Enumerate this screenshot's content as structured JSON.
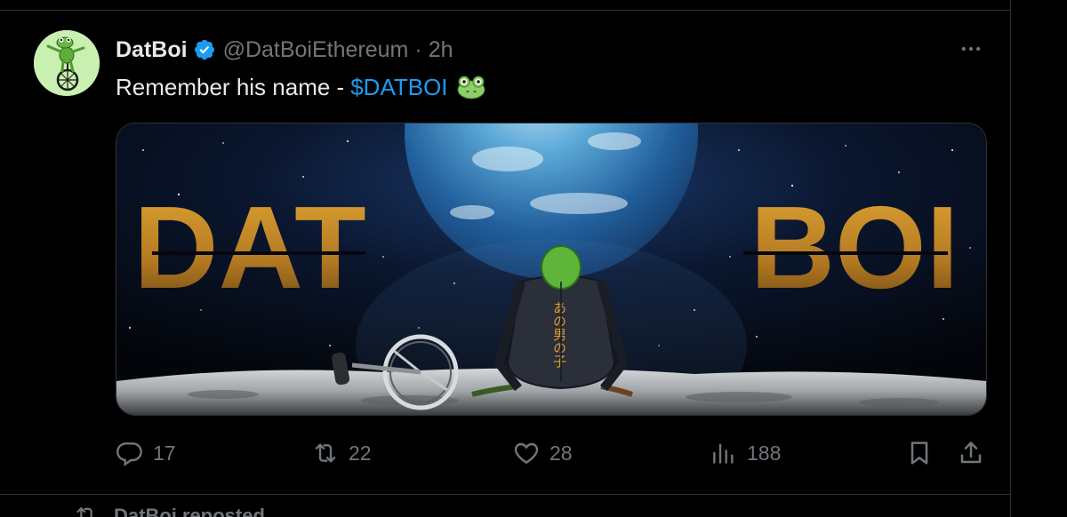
{
  "tweet": {
    "display_name": "DatBoi",
    "handle": "@DatBoiEthereum",
    "separator": "·",
    "time": "2h",
    "text": "Remember his name - ",
    "cashtag": "$DATBOI",
    "media": {
      "left_word": "DAT",
      "right_word": "BOI",
      "jacket_text": "あの男の子"
    }
  },
  "actions": {
    "replies": "17",
    "reposts": "22",
    "likes": "28",
    "views": "188"
  },
  "next": {
    "reposted_label": "DatBoi reposted"
  },
  "icons": {
    "verified": "verified-badge-icon",
    "more": "more-options-icon",
    "reply": "reply-icon",
    "repost": "repost-icon",
    "like": "like-icon",
    "views": "views-icon",
    "bookmark": "bookmark-icon",
    "share": "share-icon",
    "emoji": "frog-emoji-icon"
  },
  "colors": {
    "background": "#000000",
    "text": "#e7e9ea",
    "muted": "#71767b",
    "accent": "#1d9bf0",
    "border": "#2f3336",
    "title_gold": "#c8922a"
  }
}
